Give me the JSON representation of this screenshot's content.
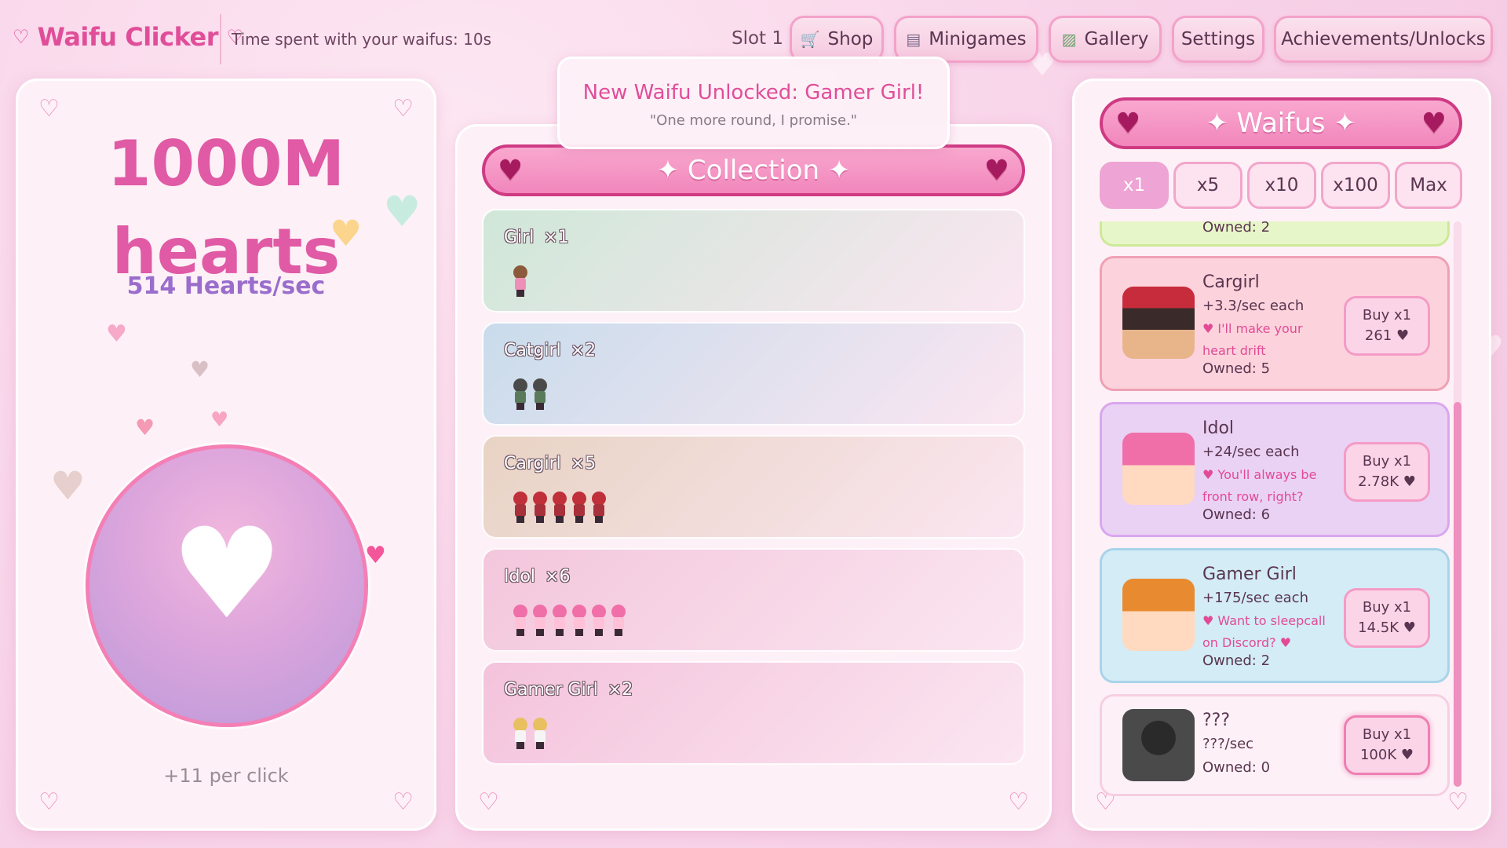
{
  "app": {
    "title": "Waifu Clicker"
  },
  "header": {
    "time_text": "Time spent with your waifus: 10s",
    "slot": "Slot 1",
    "nav": [
      {
        "label": "Shop",
        "icon": "cart-icon"
      },
      {
        "label": "Minigames",
        "icon": "gamepad-icon"
      },
      {
        "label": "Gallery",
        "icon": "picture-icon"
      },
      {
        "label": "Settings"
      },
      {
        "label": "Achievements/Unlocks"
      }
    ]
  },
  "stats": {
    "hearts_amount": "1000M",
    "hearts_word": "hearts",
    "per_sec": "514 Hearts/sec",
    "per_click": "+11 per click"
  },
  "toast": {
    "title": "New Waifu Unlocked: Gamer Girl!",
    "quote": "\"One more round, I promise.\""
  },
  "collection": {
    "title": "✦ Collection ✦",
    "items": [
      {
        "name": "Girl",
        "count": "×1",
        "n": 1,
        "bg": "#cfe7d8",
        "hair": "#8a5a3a",
        "body": "#ef8fb8"
      },
      {
        "name": "Catgirl",
        "count": "×2",
        "n": 2,
        "bg": "#c9dcec",
        "hair": "#4a4a4a",
        "body": "#5a7a5a"
      },
      {
        "name": "Cargirl",
        "count": "×5",
        "n": 5,
        "bg": "#e8d3c4",
        "hair": "#c0303a",
        "body": "#a8303a"
      },
      {
        "name": "Idol",
        "count": "×6",
        "n": 6,
        "bg": "#f3c6dc",
        "hair": "#f06fa8",
        "body": "#ffc0d8"
      },
      {
        "name": "Gamer Girl",
        "count": "×2",
        "n": 2,
        "bg": "#f4c3dc",
        "hair": "#e8c060",
        "body": "#f5f5f5"
      }
    ]
  },
  "shop": {
    "title": "✦ Waifus ✦",
    "multipliers": [
      "x1",
      "x5",
      "x10",
      "x100",
      "Max"
    ],
    "selected_multiplier": "x1",
    "partial_owned": "Owned: 2",
    "items": [
      {
        "name": "Cargirl",
        "rate": "+3.3/sec each",
        "quote1": "♥ I'll make your",
        "quote2": "heart drift",
        "owned": "Owned: 5",
        "buy": "Buy x1",
        "price": "261 ♥",
        "bg": "#fcd3dc",
        "border": "#f0a0b5",
        "icon": "cargirl-portrait"
      },
      {
        "name": "Idol",
        "rate": "+24/sec each",
        "quote1": "♥ You'll always be",
        "quote2": "front row, right?",
        "owned": "Owned: 6",
        "buy": "Buy x1",
        "price": "2.78K ♥",
        "bg": "#ead2f4",
        "border": "#d9a7ee",
        "icon": "idol-portrait"
      },
      {
        "name": "Gamer Girl",
        "rate": "+175/sec each",
        "quote1": "♥ Want to sleepcall",
        "quote2": "on Discord? ♥",
        "owned": "Owned: 2",
        "buy": "Buy x1",
        "price": "14.5K ♥",
        "bg": "#d3ecf6",
        "border": "#a8d4ea",
        "icon": "gamergirl-portrait"
      },
      {
        "name": "???",
        "rate": "???/sec",
        "quote1": "",
        "quote2": "",
        "owned": "Owned: 0",
        "buy": "Buy x1",
        "price": "100K ♥",
        "bg": "#fdf1f7",
        "border": "#f6cfe1",
        "icon": "locked-portrait"
      }
    ]
  }
}
